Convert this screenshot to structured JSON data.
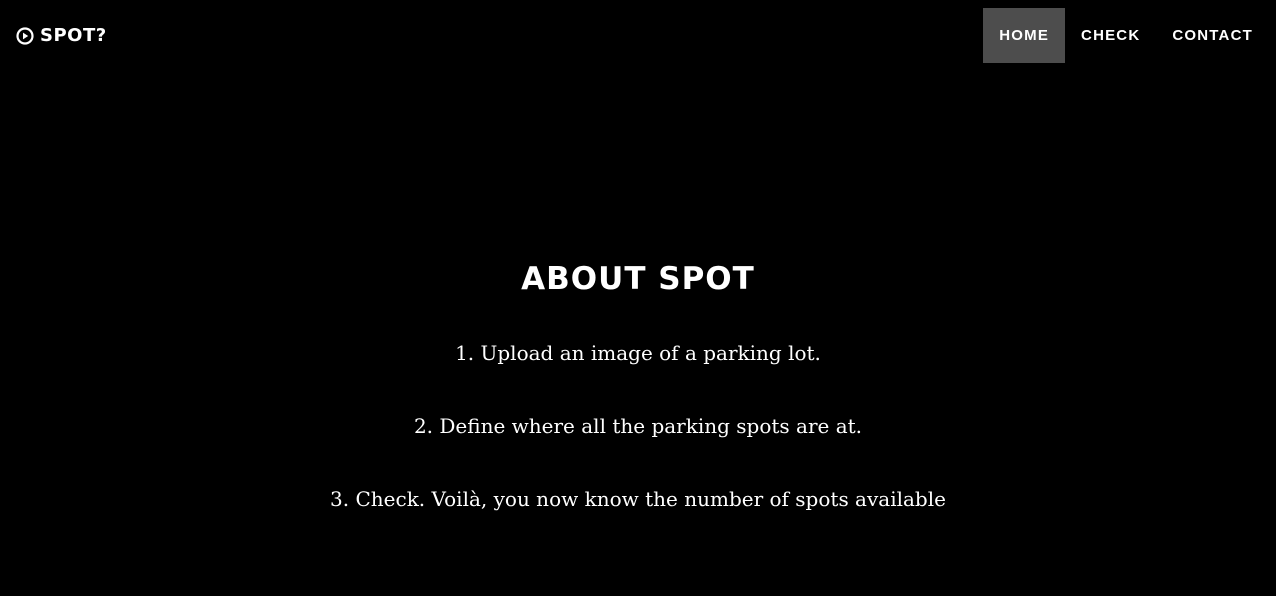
{
  "colors": {
    "background": "#000000",
    "text": "#ffffff",
    "nav_active_bg": "#4d4d4d"
  },
  "header": {
    "brand": {
      "icon": "play-circle-icon",
      "label": "SPOT?"
    },
    "nav": [
      {
        "label": "HOME",
        "active": true
      },
      {
        "label": "CHECK",
        "active": false
      },
      {
        "label": "CONTACT",
        "active": false
      }
    ]
  },
  "main": {
    "title": "ABOUT SPOT",
    "steps": [
      "1. Upload an image of a parking lot.",
      "2. Define where all the parking spots are at.",
      "3. Check. Voilà, you now know the number of spots available"
    ]
  }
}
